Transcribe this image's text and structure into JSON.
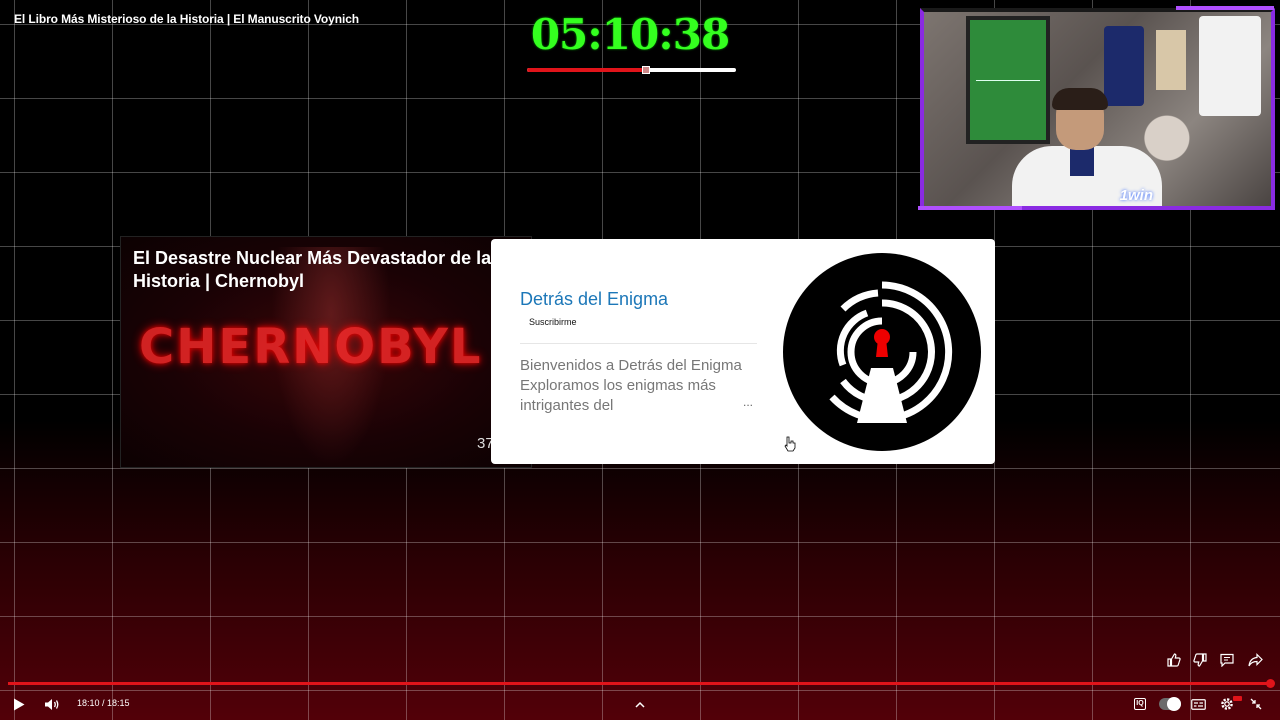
{
  "video": {
    "title": "El Libro Más Misterioso de la Historia | El Manuscrito Voynich"
  },
  "overlay_timer": {
    "value": "05:10:38",
    "progress_fraction": 0.57,
    "color": "#34ff1f",
    "track_color": "#e0141a"
  },
  "webcam": {
    "sponsor_logo": "1win",
    "frame_color": "#8a2be2"
  },
  "endscreen": {
    "video_card": {
      "title": "El Desastre Nuclear Más Devastador de la Historia | Chernobyl",
      "thumbnail_text": "CHERNOBYL",
      "views_partial": "37"
    },
    "channel_card": {
      "name": "Detrás del Enigma",
      "subscribe_label": "Suscribirme",
      "description": "Bienvenidos a Detrás del Enigma Exploramos los enigmas más intrigantes del",
      "more_label": "...",
      "name_color": "#1c77b8",
      "avatar_icon": "keyhole-labyrinth-logo"
    }
  },
  "side_actions": [
    {
      "icon": "thumbs-up-icon"
    },
    {
      "icon": "thumbs-down-icon"
    },
    {
      "icon": "comment-icon"
    },
    {
      "icon": "share-icon"
    }
  ],
  "player": {
    "progress_fraction": 0.995,
    "accent": "#e0141a",
    "time_display": "18:10 / 18:15",
    "autoplay_on": true,
    "controls": [
      "play-icon",
      "volume-icon",
      "chevron-up-icon",
      "iq-icon",
      "autoplay-toggle",
      "subtitles-icon",
      "settings-icon",
      "exit-fullscreen-icon"
    ]
  }
}
